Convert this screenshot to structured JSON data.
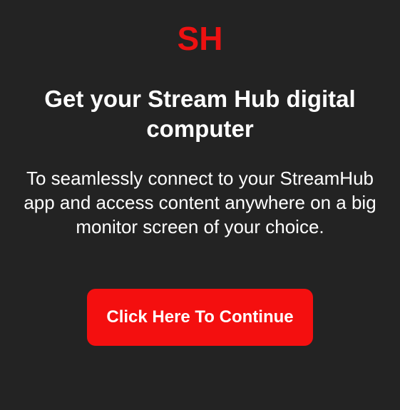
{
  "brand": {
    "logo_text": "SH",
    "accent_color": "#ee1111"
  },
  "main": {
    "headline": "Get your Stream Hub digital computer",
    "description": "To seamlessly connect to your StreamHub app and access content anywhere on a big monitor screen of your choice.",
    "cta_label": "Click Here To Continue"
  },
  "colors": {
    "background": "#232323",
    "button": "#f40f0f",
    "text": "#ffffff"
  }
}
